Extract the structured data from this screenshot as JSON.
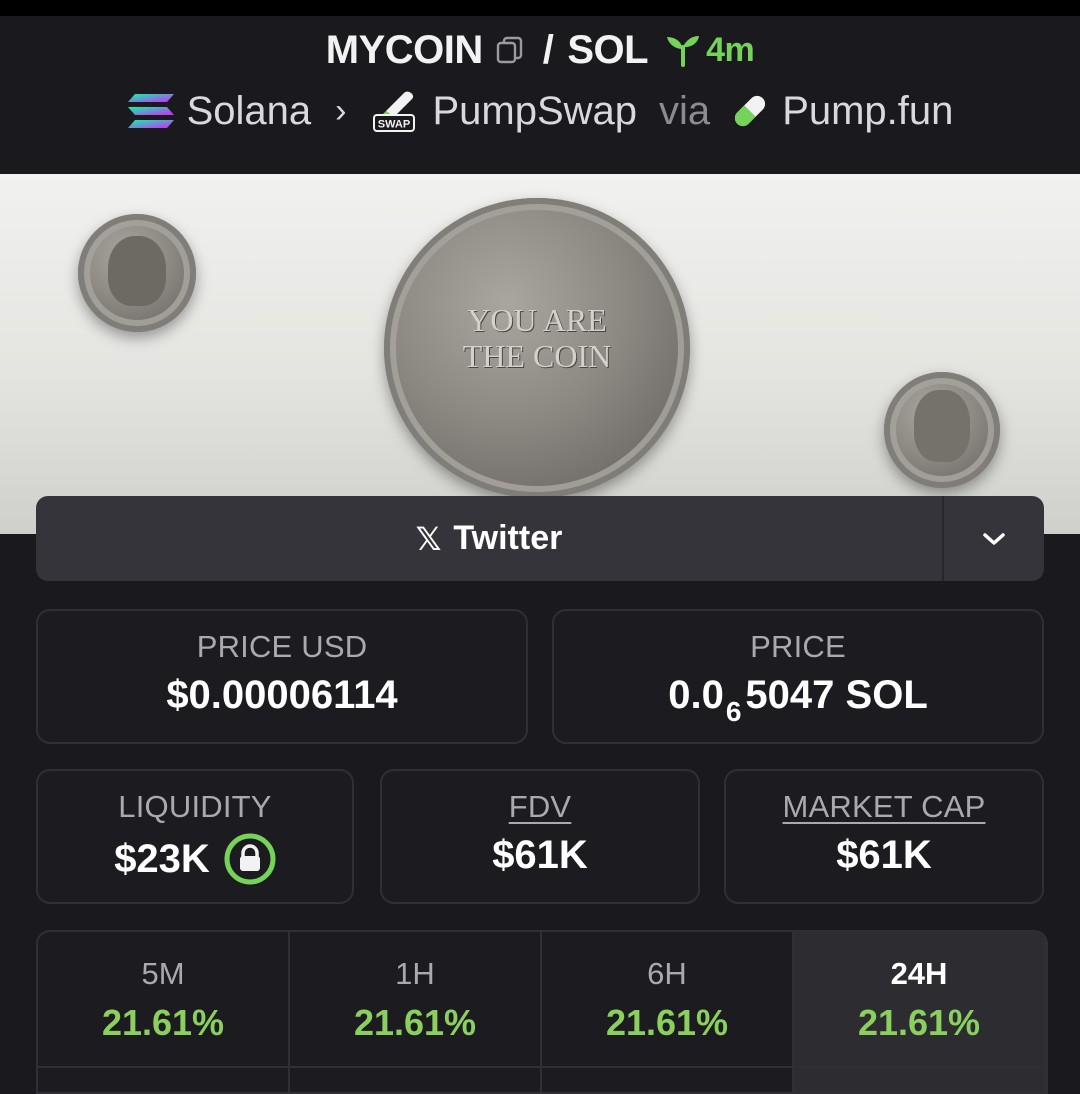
{
  "header": {
    "token": "MYCOIN",
    "quote": "SOL",
    "separator": "/",
    "age": "4m",
    "chain": "Solana",
    "dex": "PumpSwap",
    "via": "via",
    "launchpad": "Pump.fun",
    "dex_badge": "SWAP"
  },
  "banner": {
    "coin_text_line1": "YOU ARE",
    "coin_text_line2": "THE COIN"
  },
  "social": {
    "twitter_label": "Twitter"
  },
  "stats": {
    "price_usd_label": "PRICE USD",
    "price_usd_value": "$0.00006114",
    "price_label": "PRICE",
    "price_prefix": "0.0",
    "price_zero_count": "6",
    "price_suffix": "5047 SOL",
    "liquidity_label": "LIQUIDITY",
    "liquidity_value": "$23K",
    "fdv_label": "FDV",
    "fdv_value": "$61K",
    "mcap_label": "MARKET CAP",
    "mcap_value": "$61K"
  },
  "changes": [
    {
      "label": "5M",
      "value": "21.61%"
    },
    {
      "label": "1H",
      "value": "21.61%"
    },
    {
      "label": "6H",
      "value": "21.61%"
    },
    {
      "label": "24H",
      "value": "21.61%"
    }
  ],
  "colors": {
    "accent_green": "#75d35a",
    "positive": "#8bd05e",
    "background": "#1a1a1e",
    "card_border": "#2f2f35"
  },
  "icons": [
    "copy-icon",
    "sprout-icon",
    "solana-icon",
    "pumpswap-icon",
    "pill-icon",
    "x-icon",
    "chevron-down-icon",
    "lock-icon"
  ]
}
